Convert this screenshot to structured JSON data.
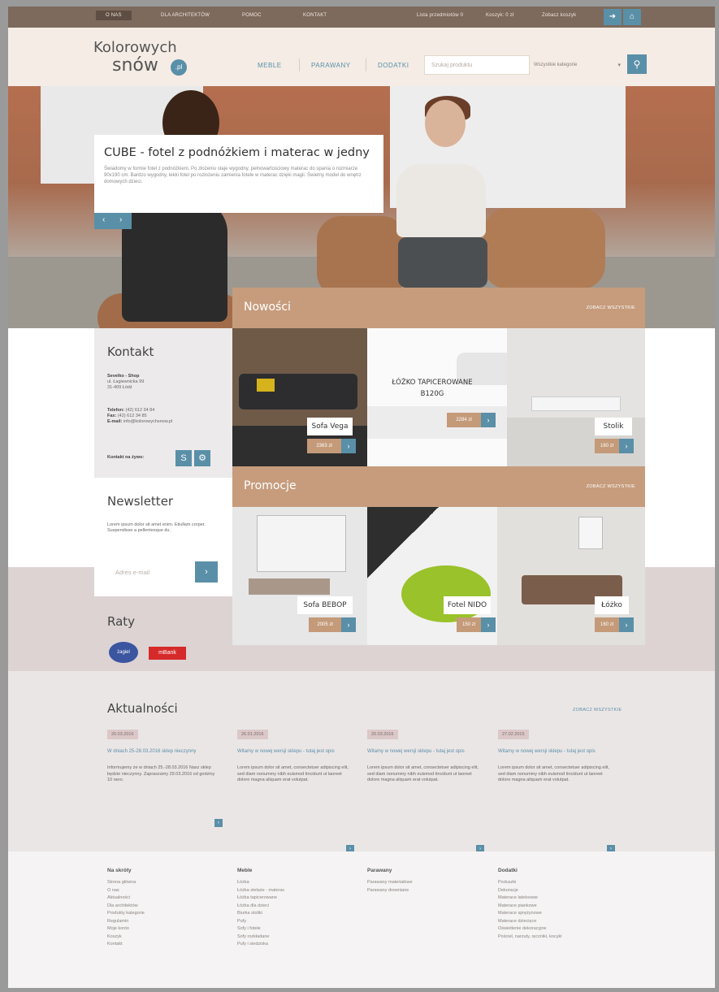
{
  "topbar": {
    "links": [
      "O NAS",
      "DLA ARCHITEKTÓW",
      "POMOC",
      "KONTAKT"
    ],
    "user_links": [
      "Lista przedmiotów 0",
      "Koszyk: 0 zł",
      "Zobacz koszyk"
    ]
  },
  "header": {
    "logo_line1": "Kolorowych",
    "logo_line2": "snów",
    "logo_badge": ".pl",
    "nav": [
      "MEBLE",
      "PARAWANY",
      "DODATKI"
    ],
    "search_placeholder": "Szukaj produktu",
    "category_select": "Wszystkie kategorie",
    "search_icon": "search-icon"
  },
  "hero": {
    "title": "CUBE - fotel z podnóżkiem i materac w jedny",
    "text": "Świadomy w formie fotel z podnóżkiem. Po złożeniu staje wygodny, pełnowartościowy materac do spania o rozmiarze 90x190 cm. Bardzo wygodny, lekki fotel po rozłożeniu zamienia fotele w materac dzięki magii. Świetny model do wnętrz domowych dzieci."
  },
  "kontakt": {
    "heading": "Kontakt",
    "company": "Sevelko - Shop",
    "address": [
      "ul. Łagiewnicka 99",
      "31-409 Łódź"
    ],
    "phone_label": "Telefon:",
    "phone": "(42) 612 34 84",
    "fax_label": "Fax:",
    "fax": "(42) 612 34 85",
    "email_label": "E-mail:",
    "email": "info@kolorowychsnow.pl",
    "live_label": "Kontakt na żywo:"
  },
  "newsletter": {
    "heading": "Newsletter",
    "text": "Lorem ipsum dolor sit amet enim. Etiullam corper. Suspendisse a pellentesque du.",
    "input_placeholder": "Adres e-mail"
  },
  "raty": {
    "heading": "Raty",
    "badge1": "żagiel",
    "badge2": "mBank"
  },
  "nowosci": {
    "title": "Nowości",
    "link": "ZOBACZ WSZYSTKIE",
    "items": [
      {
        "name": "Sofa Vega",
        "price": "2363 zł"
      },
      {
        "name": "ŁÓŻKO TAPICEROWANE B120G",
        "price": "2284 zł"
      },
      {
        "name": "Stolik",
        "price": "160 zł"
      }
    ]
  },
  "promocje": {
    "title": "Promocje",
    "link": "ZOBACZ WSZYSTKIE",
    "items": [
      {
        "name": "Sofa BEBOP",
        "price": "2005 zł"
      },
      {
        "name": "Fotel NIDO",
        "price": "150 zł"
      },
      {
        "name": "Łóżko",
        "price": "160 zł"
      }
    ]
  },
  "aktualnosci": {
    "heading": "Aktualności",
    "link": "ZOBACZ WSZYSTKIE",
    "items": [
      {
        "date": "20.03.2016",
        "title": "W dniach 25-28.03.2016 sklep nieczynny",
        "text": "Informujemy że w dniach 25.-28.03.2016 Nasz sklep będzie nieczynny. Zapraszamy 29.03.2016 od godziny 10 rano."
      },
      {
        "date": "26.01.2016",
        "title": "Witamy w nowej wersji sklepu - tutaj jest opis",
        "text": "Lorem ipsum dolor sit amet, consectetuer adipiscing elit, sed diam nonummy nibh euismod tincidunt ut laoreet dolore magna aliquam erat volutpat."
      },
      {
        "date": "20.03.2016",
        "title": "Witamy w nowej wersji sklepu - tutaj jest opis",
        "text": "Lorem ipsum dolor sit amet, consectetuer adipiscing elit, sed diam nonummy nibh euismod tincidunt ut laoreet dolore magna aliquam erat volutpat."
      },
      {
        "date": "27.02.2015",
        "title": "Witamy w nowej wersji sklepu - tutaj jest opis",
        "text": "Lorem ipsum dolor sit amet, consectetuer adipiscing elit, sed diam nonummy nibh euismod tincidunt ut laoreet dolore magna aliquam erat volutpat."
      }
    ]
  },
  "footer": {
    "cols": [
      {
        "heading": "Na skróty",
        "items": [
          "Strona główna",
          "O nas",
          "Aktualności",
          "Dla architektów",
          "Produkty kategorie",
          "Regulamin",
          "Moje konto",
          "Koszyk",
          "Kontakt"
        ]
      },
      {
        "heading": "Meble",
        "items": [
          "Łóżka",
          "Łóżka stelaże - materac",
          "Łóżka tapicerowane",
          "Łóżka dla dzieci",
          "Biurka stoliki",
          "Pufy",
          "Sofy i fotele",
          "Sofy rozkładane",
          "Pufy i siedziska"
        ]
      },
      {
        "heading": "Parawany",
        "items": [
          "Parawany materiałowe",
          "Parawany drewniane"
        ]
      },
      {
        "heading": "Dodatki",
        "items": [
          "Poduszki",
          "Dekoracje",
          "Materace lateksowe",
          "Materace piankowe",
          "Materace sprężynowe",
          "Materace dziecięce",
          "Oświetlenie dekoracyjne",
          "Pościel, narzuty, ręczniki, kocyki"
        ]
      }
    ]
  }
}
